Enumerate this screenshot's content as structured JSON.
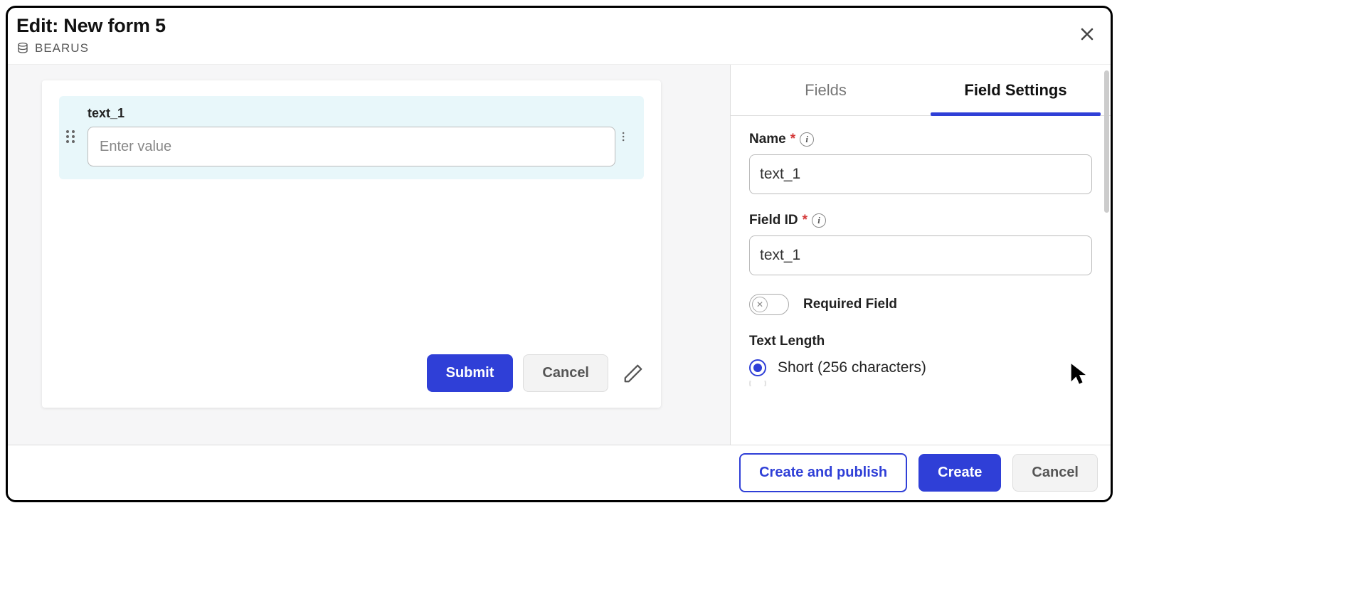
{
  "header": {
    "title_prefix": "Edit: ",
    "title_name": "New form 5",
    "database_name": "BEARUS"
  },
  "canvas": {
    "field": {
      "label": "text_1",
      "placeholder": "Enter value"
    },
    "submit_label": "Submit",
    "cancel_label": "Cancel"
  },
  "tabs": {
    "fields": "Fields",
    "field_settings": "Field Settings"
  },
  "settings": {
    "name_label": "Name",
    "name_value": "text_1",
    "field_id_label": "Field ID",
    "field_id_value": "text_1",
    "required_label": "Required Field",
    "text_length_label": "Text Length",
    "short_option": "Short (256 characters)"
  },
  "footer": {
    "create_publish": "Create and publish",
    "create": "Create",
    "cancel": "Cancel"
  }
}
